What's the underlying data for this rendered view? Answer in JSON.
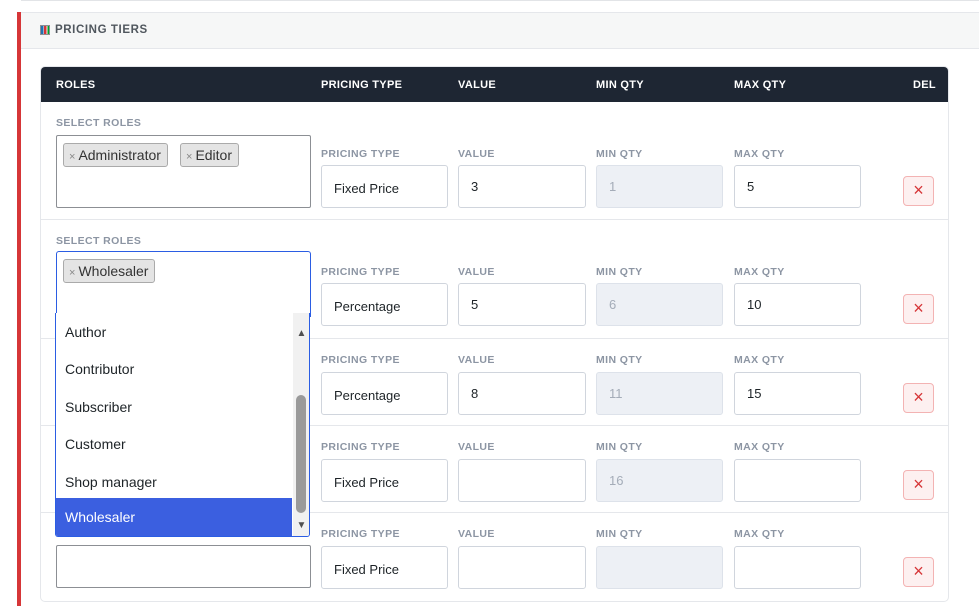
{
  "section": {
    "title": "PRICING TIERS",
    "icon": "chart-icon"
  },
  "table": {
    "headers": {
      "roles": "ROLES",
      "pricing_type": "PRICING TYPE",
      "value": "VALUE",
      "min_qty": "MIN QTY",
      "max_qty": "MAX QTY",
      "del": "DEL"
    },
    "field_labels": {
      "select_roles": "SELECT ROLES",
      "pricing_type": "PRICING TYPE",
      "value": "VALUE",
      "min_qty": "MIN QTY",
      "max_qty": "MAX QTY"
    },
    "rows": [
      {
        "roles": [
          "Administrator",
          "Editor"
        ],
        "pricing_type": "Fixed Price",
        "value": "3",
        "min_qty": "1",
        "max_qty": "5"
      },
      {
        "roles": [
          "Wholesaler"
        ],
        "pricing_type": "Percentage",
        "value": "5",
        "min_qty": "6",
        "max_qty": "10"
      },
      {
        "roles": [],
        "pricing_type": "Percentage",
        "value": "8",
        "min_qty": "11",
        "max_qty": "15"
      },
      {
        "roles": [],
        "pricing_type": "Fixed Price",
        "value": "",
        "min_qty": "16",
        "max_qty": ""
      },
      {
        "roles": [],
        "pricing_type": "Fixed Price",
        "value": "",
        "min_qty": "",
        "max_qty": ""
      }
    ],
    "tag_remove_glyph": "×",
    "delete_glyph": "×"
  },
  "dropdown": {
    "options": [
      "Author",
      "Contributor",
      "Subscriber",
      "Customer",
      "Shop manager",
      "Wholesaler"
    ],
    "selected": "Wholesaler"
  },
  "colors": {
    "accent_red": "#d63638",
    "header_bg": "#1e2633",
    "selected_option": "#3b5fe0"
  }
}
